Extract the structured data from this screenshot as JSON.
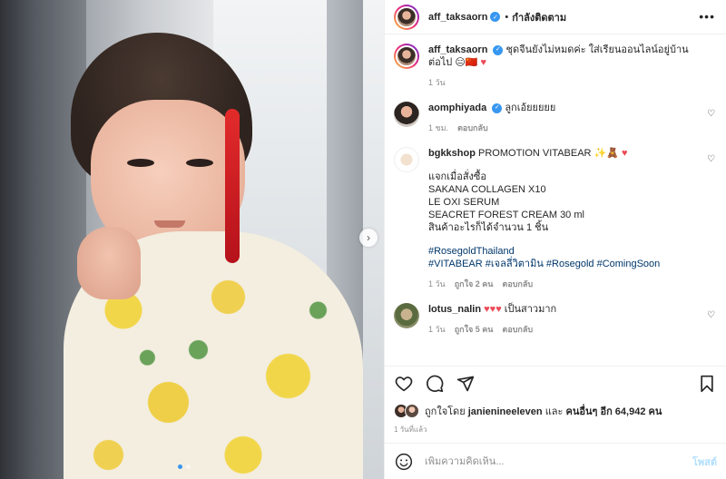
{
  "post": {
    "username": "aff_taksaorn",
    "follow_status": "กำลังติดตาม",
    "separator": "•",
    "caption": "ชุดจีนยังไม่หมดค่ะ ใส่เรียนออนไลน์อยู่บ้านต่อไป 😑🇨🇳",
    "caption_heart": "♥",
    "caption_time": "1 วัน",
    "more_icon": "more-horizontal-icon"
  },
  "comments": [
    {
      "username": "aomphiyada",
      "verified": true,
      "text": "ลูกเอ้ยยยยย",
      "time": "1 ชม.",
      "reply": "ตอบกลับ",
      "likes": ""
    },
    {
      "username": "bgkkshop",
      "verified": false,
      "text_head": "PROMOTION VITABEAR ✨🧸",
      "text_head_heart": "♥",
      "lines": [
        "แจกเมื่อสั่งซื้อ",
        "SAKANA COLLAGEN X10",
        "LE OXI SERUM",
        "SEACRET FOREST CREAM 30 ml",
        "สินค้าอะไรก็ได้จำนวน 1 ชิ้น"
      ],
      "hashtags_1": "#RosegoldThailand",
      "hashtags_2": [
        "#VITABEAR",
        "#เจลลี่วิตามิน",
        "#Rosegold",
        "#ComingSoon"
      ],
      "time": "1 วัน",
      "likes": "ถูกใจ 2 คน",
      "reply": "ตอบกลับ"
    },
    {
      "username": "lotus_nalin",
      "verified": false,
      "hearts": "♥♥♥",
      "text": "เป็นสาวมาก",
      "time": "1 วัน",
      "likes": "ถูกใจ 5 คน",
      "reply": "ตอบกลับ"
    }
  ],
  "actions": {
    "like_icon": "heart-outline-icon",
    "comment_icon": "comment-icon",
    "share_icon": "share-icon",
    "save_icon": "bookmark-icon"
  },
  "likes": {
    "prefix": "ถูกใจโดย",
    "first_user": "janienineeleven",
    "middle": "และ",
    "others": "คนอื่นๆ อีก 64,942 คน"
  },
  "timestamp": "1 วันที่แล้ว",
  "add_comment": {
    "placeholder": "เพิ่มความคิดเห็น...",
    "post_label": "โพสต์"
  },
  "colors": {
    "accent": "#3897f0",
    "hashtag": "#00376b",
    "heart": "#ed4956",
    "post_disabled": "#b2dffc"
  }
}
